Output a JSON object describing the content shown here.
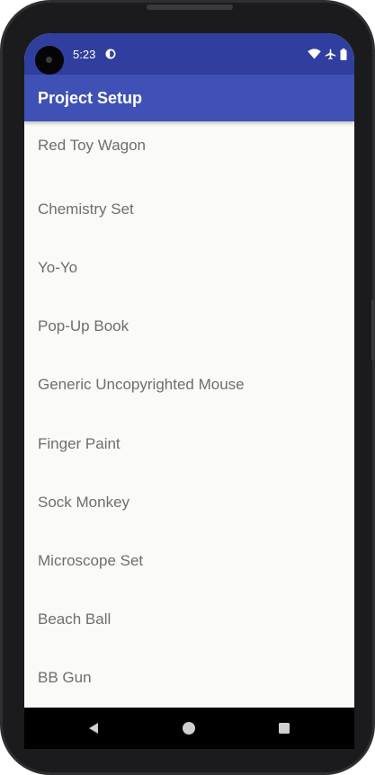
{
  "status_bar": {
    "time": "5:23",
    "icons": [
      "camera-icon",
      "app-notification-icon",
      "wifi-icon",
      "airplane-icon",
      "battery-icon"
    ]
  },
  "app_bar": {
    "title": "Project Setup"
  },
  "list": {
    "items": [
      {
        "label": "Red Toy Wagon"
      },
      {
        "label": "Chemistry Set"
      },
      {
        "label": "Yo-Yo"
      },
      {
        "label": "Pop-Up Book"
      },
      {
        "label": "Generic Uncopyrighted Mouse"
      },
      {
        "label": "Finger Paint"
      },
      {
        "label": "Sock Monkey"
      },
      {
        "label": "Microscope Set"
      },
      {
        "label": "Beach Ball"
      },
      {
        "label": "BB Gun"
      }
    ]
  },
  "nav_bar": {
    "icons": [
      "back-icon",
      "home-icon",
      "recents-icon"
    ]
  },
  "colors": {
    "status_bar": "#303f9f",
    "app_bar": "#3f51b5",
    "background": "#fafaf6",
    "item_text": "#6e6e6e",
    "bezel": "#1b1b1d"
  }
}
